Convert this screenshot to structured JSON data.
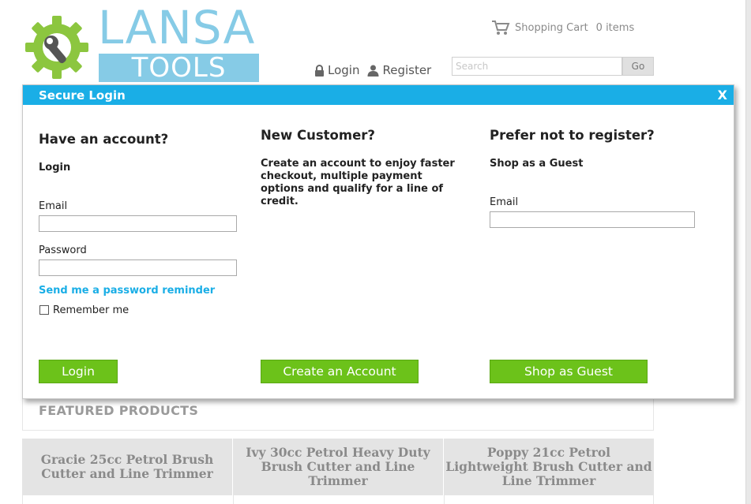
{
  "header": {
    "logo": {
      "line1": "LANSA",
      "line2": "TOOLS",
      "gear_color": "#8cc63f",
      "text_color": "#86cbe6"
    },
    "cart": {
      "label": "Shopping Cart",
      "count": "0 items",
      "icon": "cart-icon"
    },
    "auth": {
      "login_label": "Login",
      "register_label": "Register",
      "login_icon": "lock-icon",
      "register_icon": "user-icon"
    },
    "search": {
      "placeholder": "Search",
      "value": "",
      "button_label": "Go"
    }
  },
  "modal": {
    "title": "Secure Login",
    "close_label": "X",
    "header_color": "#1aaee6",
    "account": {
      "heading": "Have an account?",
      "subheading": "Login",
      "email_label": "Email",
      "email_value": "",
      "password_label": "Password",
      "password_value": "",
      "reminder_link": "Send me a password reminder",
      "remember_label": "Remember me",
      "remember_checked": false,
      "button_label": "Login"
    },
    "new_customer": {
      "heading": "New Customer?",
      "description": "Create an account to enjoy faster checkout, multiple payment options and qualify for a line of credit.",
      "button_label": "Create an Account"
    },
    "guest": {
      "heading": "Prefer not to register?",
      "subheading": "Shop as a Guest",
      "email_label": "Email",
      "email_value": "",
      "button_label": "Shop as Guest"
    },
    "button_color": "#6cc21a"
  },
  "featured": {
    "title": "FEATURED PRODUCTS",
    "products": [
      {
        "name": "Gracie 25cc Petrol Brush Cutter and Line Trimmer"
      },
      {
        "name": "Ivy 30cc Petrol Heavy Duty Brush Cutter and Line Trimmer"
      },
      {
        "name": "Poppy 21cc Petrol Lightweight Brush Cutter and Line Trimmer"
      }
    ]
  }
}
